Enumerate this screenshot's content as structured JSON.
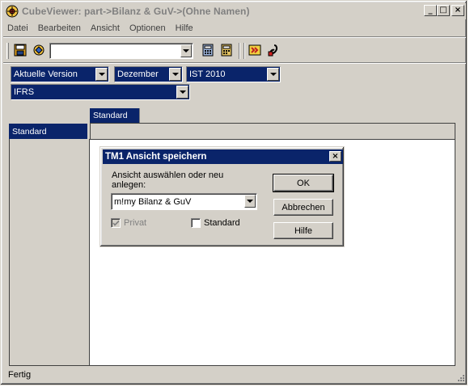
{
  "window": {
    "title": "CubeViewer: part->Bilanz & GuV->(Ohne Namen)",
    "minimize_glyph": "_",
    "maximize_glyph": "□",
    "close_glyph": "×"
  },
  "menu": [
    "Datei",
    "Bearbeiten",
    "Ansicht",
    "Optionen",
    "Hilfe"
  ],
  "toolbar": {
    "view_combo_value": "",
    "icons": [
      "save-view-icon",
      "open-view-icon",
      "calculator-icon",
      "recalc-icon",
      "export-icon",
      "format-icon"
    ]
  },
  "dimensions": {
    "version": "Aktuelle Version",
    "month": "Dezember",
    "scenario": "IST 2010",
    "standard": "IFRS"
  },
  "grid": {
    "column_title": "Standard",
    "row_title": "Standard"
  },
  "status": {
    "text": "Fertig"
  },
  "dialog": {
    "title": "TM1 Ansicht speichern",
    "prompt": "Ansicht auswählen oder neu anlegen:",
    "view_name": "m!my Bilanz & GuV",
    "ok_label": "OK",
    "cancel_label": "Abbrechen",
    "help_label": "Hilfe",
    "private_label": "Privat",
    "private_checked": true,
    "standard_label": "Standard",
    "standard_checked": false
  },
  "colors": {
    "face": "#d4d0c8",
    "selection": "#0a246a",
    "disabled_text": "#808080"
  }
}
